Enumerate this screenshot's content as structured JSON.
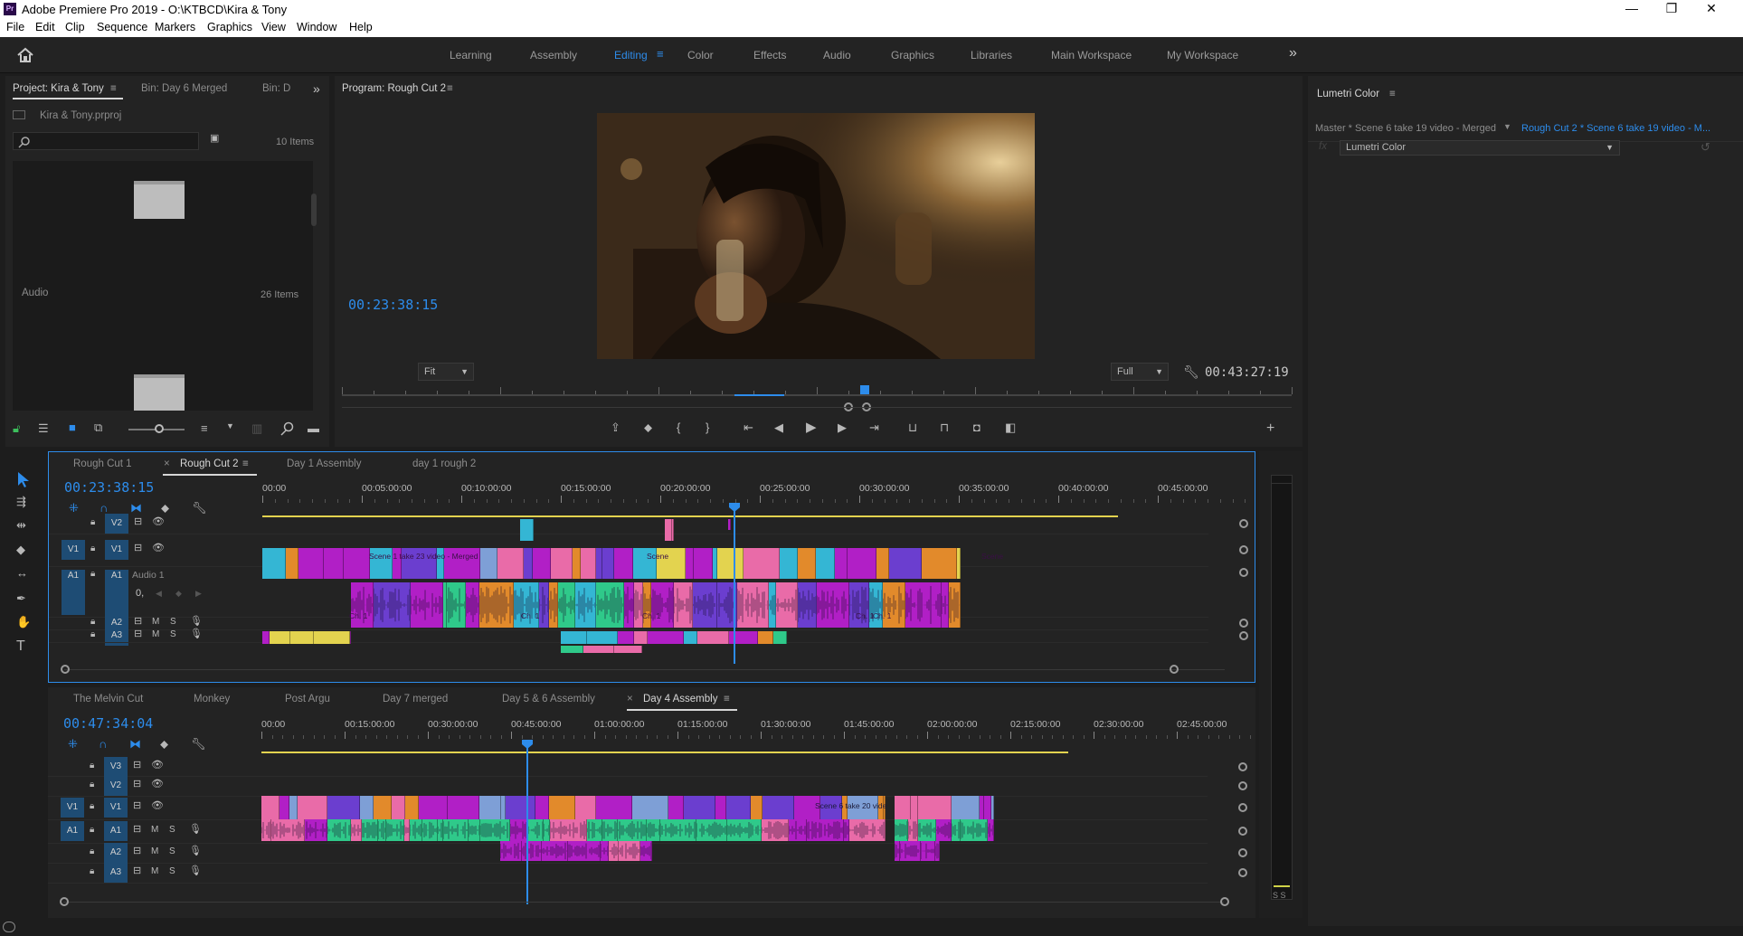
{
  "window": {
    "logo": "Pr",
    "title": "Adobe Premiere Pro 2019 - O:\\KTBCD\\Kira & Tony",
    "minimize": "—",
    "maximize": "❐",
    "close": "✕"
  },
  "menu": [
    "File",
    "Edit",
    "Clip",
    "Sequence",
    "Markers",
    "Graphics",
    "View",
    "Window",
    "Help"
  ],
  "workspaces": {
    "items": [
      "Learning",
      "Assembly",
      "Editing",
      "Color",
      "Effects",
      "Audio",
      "Graphics",
      "Libraries",
      "Main Workspace",
      "My Workspace"
    ],
    "active": "Editing",
    "more_icon": "»"
  },
  "project_panel": {
    "tabs": [
      "Project: Kira & Tony",
      "Bin: Day 6 Merged",
      "Bin: D"
    ],
    "project_file": "Kira & Tony.prproj",
    "item_count": "10 Items",
    "bins": [
      {
        "name": "",
        "count": ""
      },
      {
        "name": "Audio",
        "count": "26 Items"
      }
    ]
  },
  "program_monitor": {
    "title": "Program: Rough Cut 2",
    "current_time": "00:23:38:15",
    "zoom": "Fit",
    "resolution": "Full",
    "duration": "00:43:27:19",
    "playhead_fraction": 0.55
  },
  "lumetri": {
    "title": "Lumetri Color",
    "master_clip": "Master * Scene 6 take 19 video - Merged",
    "sequence_clip": "Rough Cut 2 * Scene 6 take 19 video - M...",
    "effect": "Lumetri Color"
  },
  "timeline1": {
    "tabs": [
      "Rough Cut 1",
      "Rough Cut 2",
      "Day 1 Assembly",
      "day 1 rough 2"
    ],
    "active_tab": "Rough Cut 2",
    "close_icon": "×",
    "timecode": "00:23:38:15",
    "ruler": [
      "00:00",
      "00:05:00:00",
      "00:10:00:00",
      "00:15:00:00",
      "00:20:00:00",
      "00:25:00:00",
      "00:30:00:00",
      "00:35:00:00",
      "00:40:00:00",
      "00:45:00:00"
    ],
    "tracks": {
      "v2": "V2",
      "v1_src": "V1",
      "v1": "V1",
      "a1_src": "A1",
      "a1": "A1",
      "a1_name": "Audio 1",
      "a2": "A2",
      "a3": "A3",
      "volume": "0,"
    },
    "clip_labels": [
      "Scene 1 take 23 video - Merged",
      "Scene",
      "Scene",
      "Ch. 1",
      "Ch. 1",
      "Ch. 1",
      "Ch. 1",
      "Ch. 1"
    ]
  },
  "timeline2": {
    "tabs": [
      "The Melvin Cut",
      "Monkey",
      "Post Argu",
      "Day 7 merged",
      "Day 5 & 6 Assembly",
      "Day 4 Assembly"
    ],
    "active_tab": "Day 4 Assembly",
    "close_icon": "×",
    "timecode": "00:47:34:04",
    "ruler": [
      "00:00",
      "00:15:00:00",
      "00:30:00:00",
      "00:45:00:00",
      "01:00:00:00",
      "01:15:00:00",
      "01:30:00:00",
      "01:45:00:00",
      "02:00:00:00",
      "02:15:00:00",
      "02:30:00:00",
      "02:45:00:00"
    ],
    "tracks": {
      "v3": "V3",
      "v2": "V2",
      "v1_src": "V1",
      "v1": "V1",
      "a1_src": "A1",
      "a1": "A1",
      "a2": "A2",
      "a3": "A3"
    },
    "clip_labels": [
      "Scene 6 take 20 vide"
    ]
  },
  "track_controls": {
    "mute": "M",
    "solo": "S",
    "fx": "fx"
  },
  "meter": {
    "labels": "S S"
  },
  "colors": {
    "accent": "#2d8ceb",
    "magenta": "#b11fc6",
    "pink": "#e96ba8",
    "cyan": "#34b6d4",
    "blue": "#7e9fd6",
    "yellow": "#e3d34f",
    "orange": "#e28a2b",
    "green": "#2fc98a",
    "purple": "#6b3ecf"
  }
}
